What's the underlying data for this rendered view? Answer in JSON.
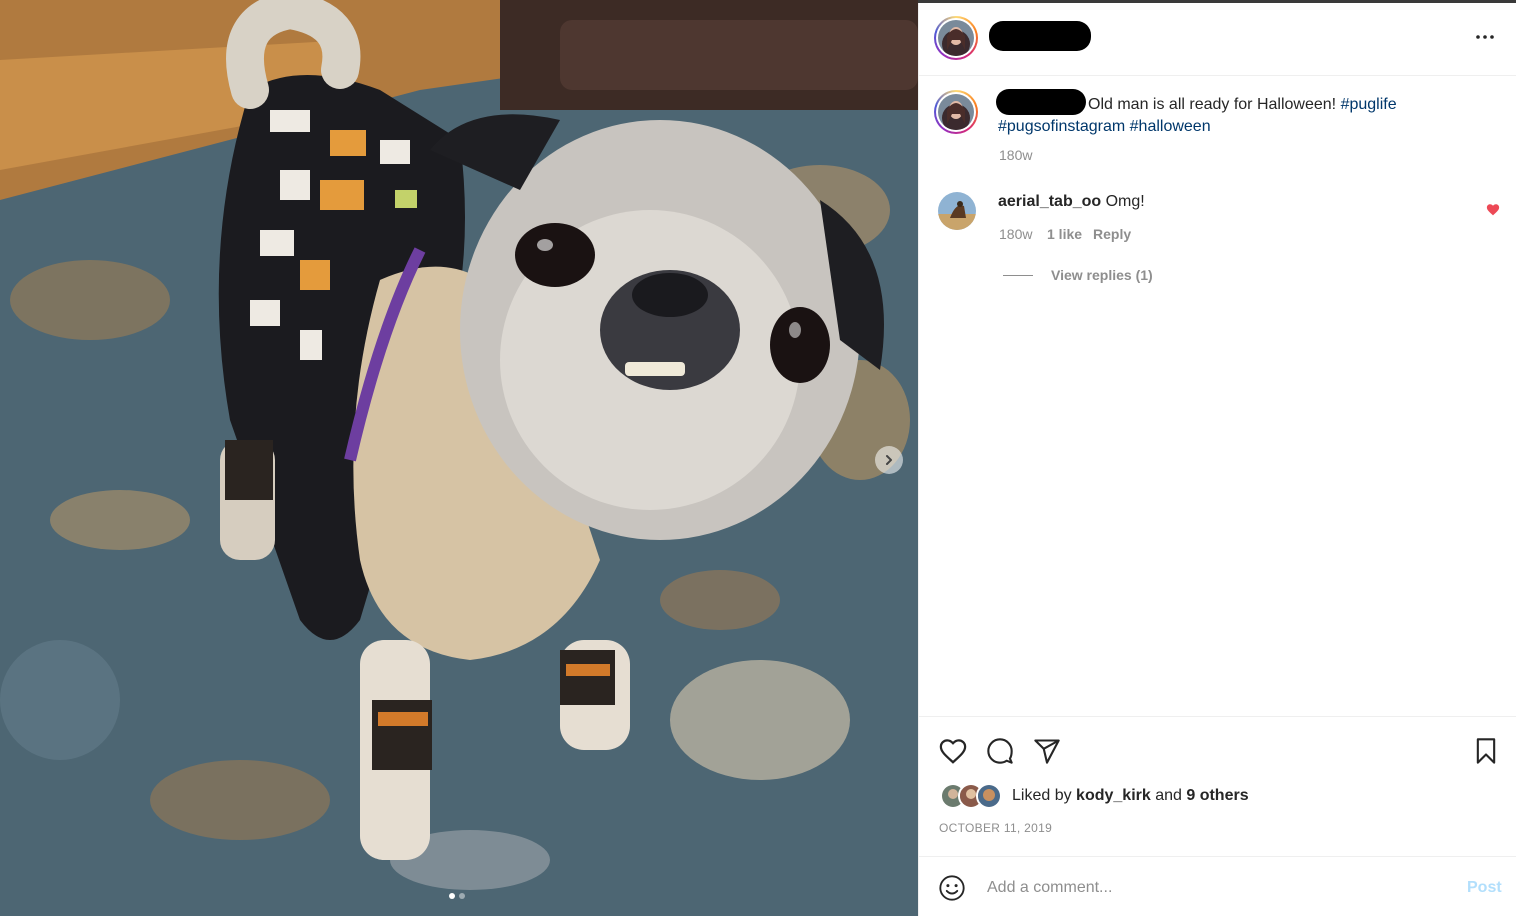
{
  "post": {
    "caption_text": "Old man is all ready for Halloween!",
    "hashtags": [
      "#puglife",
      "#pugsofinstagram",
      "#halloween"
    ],
    "caption_time": "180w",
    "photo_alt": "Pug wearing a Halloween sweater on a rug",
    "carousel": {
      "slide_count": 2,
      "active_slide": 1
    }
  },
  "header": {
    "more_icon": "more-horizontal-icon"
  },
  "comments": [
    {
      "username": "aerial_tab_oo",
      "text": "Omg!",
      "time": "180w",
      "likes": "1 like",
      "reply_label": "Reply",
      "liked": true
    }
  ],
  "view_replies_label": "View replies (1)",
  "likes": {
    "prefix": "Liked by ",
    "user": "kody_kirk",
    "conjunction": " and ",
    "others": "9 others"
  },
  "date": "OCTOBER 11, 2019",
  "comment_box": {
    "placeholder": "Add a comment...",
    "post_label": "Post"
  },
  "colors": {
    "hashtag": "#00376b",
    "liked_heart": "#ed4956",
    "post_disabled": "#b2dffc",
    "meta": "#8e8e8e"
  }
}
